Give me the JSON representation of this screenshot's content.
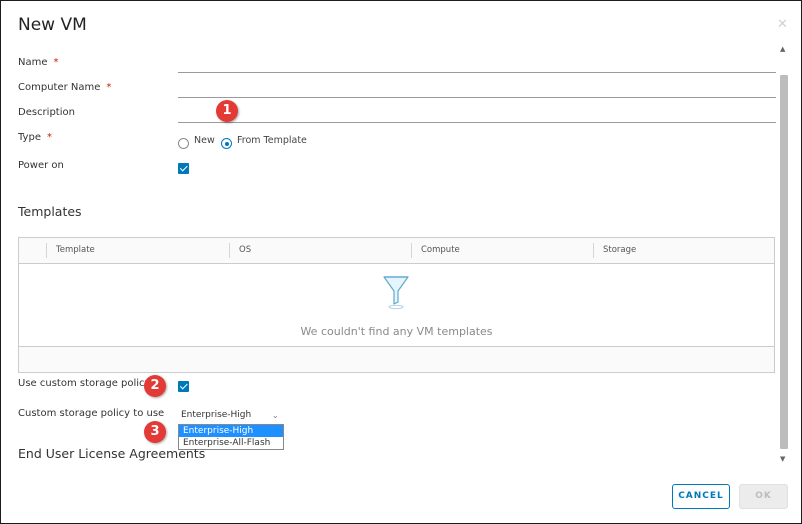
{
  "dialog": {
    "title": "New VM",
    "close_glyph": "✕"
  },
  "form": {
    "name_label": "Name",
    "computer_name_label": "Computer Name",
    "description_label": "Description",
    "type_label": "Type",
    "required_mark": "*",
    "type_options": [
      {
        "label": "New",
        "selected": false
      },
      {
        "label": "From Template",
        "selected": true
      }
    ],
    "power_on_label": "Power on",
    "power_on_checked": true
  },
  "templates": {
    "section_title": "Templates",
    "columns": [
      "Template",
      "OS",
      "Compute",
      "Storage"
    ],
    "empty_message": "We couldn't find any VM templates",
    "empty_icon": "funnel-icon"
  },
  "storage": {
    "custom_policy_label": "Use custom storage policy",
    "custom_policy_checked": true,
    "policy_to_use_label": "Custom storage policy to use",
    "selected_value": "Enterprise-High",
    "options": [
      "Enterprise-High",
      "Enterprise-All-Flash"
    ]
  },
  "eula": {
    "section_title": "End User License Agreements"
  },
  "annotations": {
    "badge_1": "1",
    "badge_2": "2",
    "badge_3": "3",
    "badge_color": "#e33a35"
  },
  "buttons": {
    "cancel_label": "CANCEL",
    "ok_label": "OK"
  },
  "colors": {
    "accent": "#0079b8",
    "required": "#c92100"
  }
}
